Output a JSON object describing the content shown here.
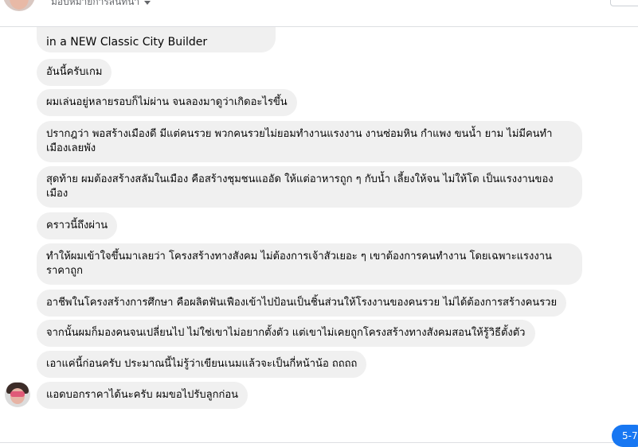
{
  "header": {
    "assign_label": "มอบหมายการสนทนา"
  },
  "messages": [
    {
      "text": "in a NEW Classic City Builder"
    },
    {
      "text": "อันนี้ครับเกม"
    },
    {
      "text": "ผมเล่นอยู่หลายรอบก็ไม่ผ่าน จนลองมาดูว่าเกิดอะไรขึ้น"
    },
    {
      "text": "ปรากฎว่า พอสร้างเมืองดี มีแต่คนรวย พวกคนรวยไม่ยอมทำงานแรงงาน งานซ่อมหิน กำแพง ขนน้ำ ยาม ไม่มีคนทำ เมืองเลยพัง"
    },
    {
      "text": "สุดท้าย ผมต้องสร้างสลัมในเมือง คือสร้างชุมชนแออัด ให้แต่อาหารถูก ๆ กับน้ำ เลี้ยงให้จน ไม่ให้โต เป็นแรงงานของเมือง"
    },
    {
      "text": "คราวนี้ถึงผ่าน"
    },
    {
      "text": "ทำให้ผมเข้าใจขึ้นมาเลยว่า โครงสร้างทางสังคม ไม่ต้องการเจ้าสัวเยอะ ๆ เขาต้องการคนทำงาน โดยเฉพาะแรงงานราคาถูก"
    },
    {
      "text": "อาชีพในโครงสร้างการศึกษา คือผลิตฟันเฟืองเข้าไปป้อนเป็นชิ้นส่วนให้โรงงานของคนรวย ไม่ได้ต้องการสร้างคนรวย"
    },
    {
      "text": "จากนั้นผมก็มองคนจนเปลี่ยนไป ไม่ใช่เขาไม่อยากตั้งตัว แต่เขาไม่เคยถูกโครงสร้างทางสังคมสอนให้รู้วิธีตั้งตัว"
    },
    {
      "text": "เอาแค่นี้ก่อนครับ ประมาณนี้ไม่รู้ว่าเขียนเนมแล้วจะเป็นกี่หน้าน้อ ถถถถ"
    },
    {
      "text": "แอดบอกราคาได้นะครับ ผมขอไปรับลูกก่อน"
    }
  ],
  "pager": {
    "label": "5-7"
  },
  "icons": {
    "assign_caret": "caret-down-icon"
  },
  "colors": {
    "bubble_bg": "#f0f0f0",
    "accent": "#1877f2",
    "divider": "#dddfe2"
  }
}
